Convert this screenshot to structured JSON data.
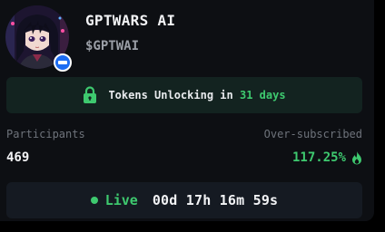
{
  "project": {
    "title": "GPTWARS AI",
    "ticker": "$GPTWAI",
    "avatar_icon": "anime-character-avatar",
    "badge_icon": "verified-badge-icon"
  },
  "unlock": {
    "prefix": "Tokens Unlocking in",
    "days": "31 days",
    "icon": "lock-icon"
  },
  "stats": {
    "participants_label": "Participants",
    "participants_value": "469",
    "oversubscribed_label": "Over-subscribed",
    "oversubscribed_value": "117.25%",
    "oversubscribed_icon": "fire-icon"
  },
  "status": {
    "live_label": "Live",
    "countdown": "00d 17h 16m 59s"
  },
  "colors": {
    "accent_green": "#3ec96f",
    "badge_blue": "#1d6cf2",
    "card_bg": "#0d0f13",
    "unlock_bg": "#132320",
    "live_bg": "#151a22"
  }
}
